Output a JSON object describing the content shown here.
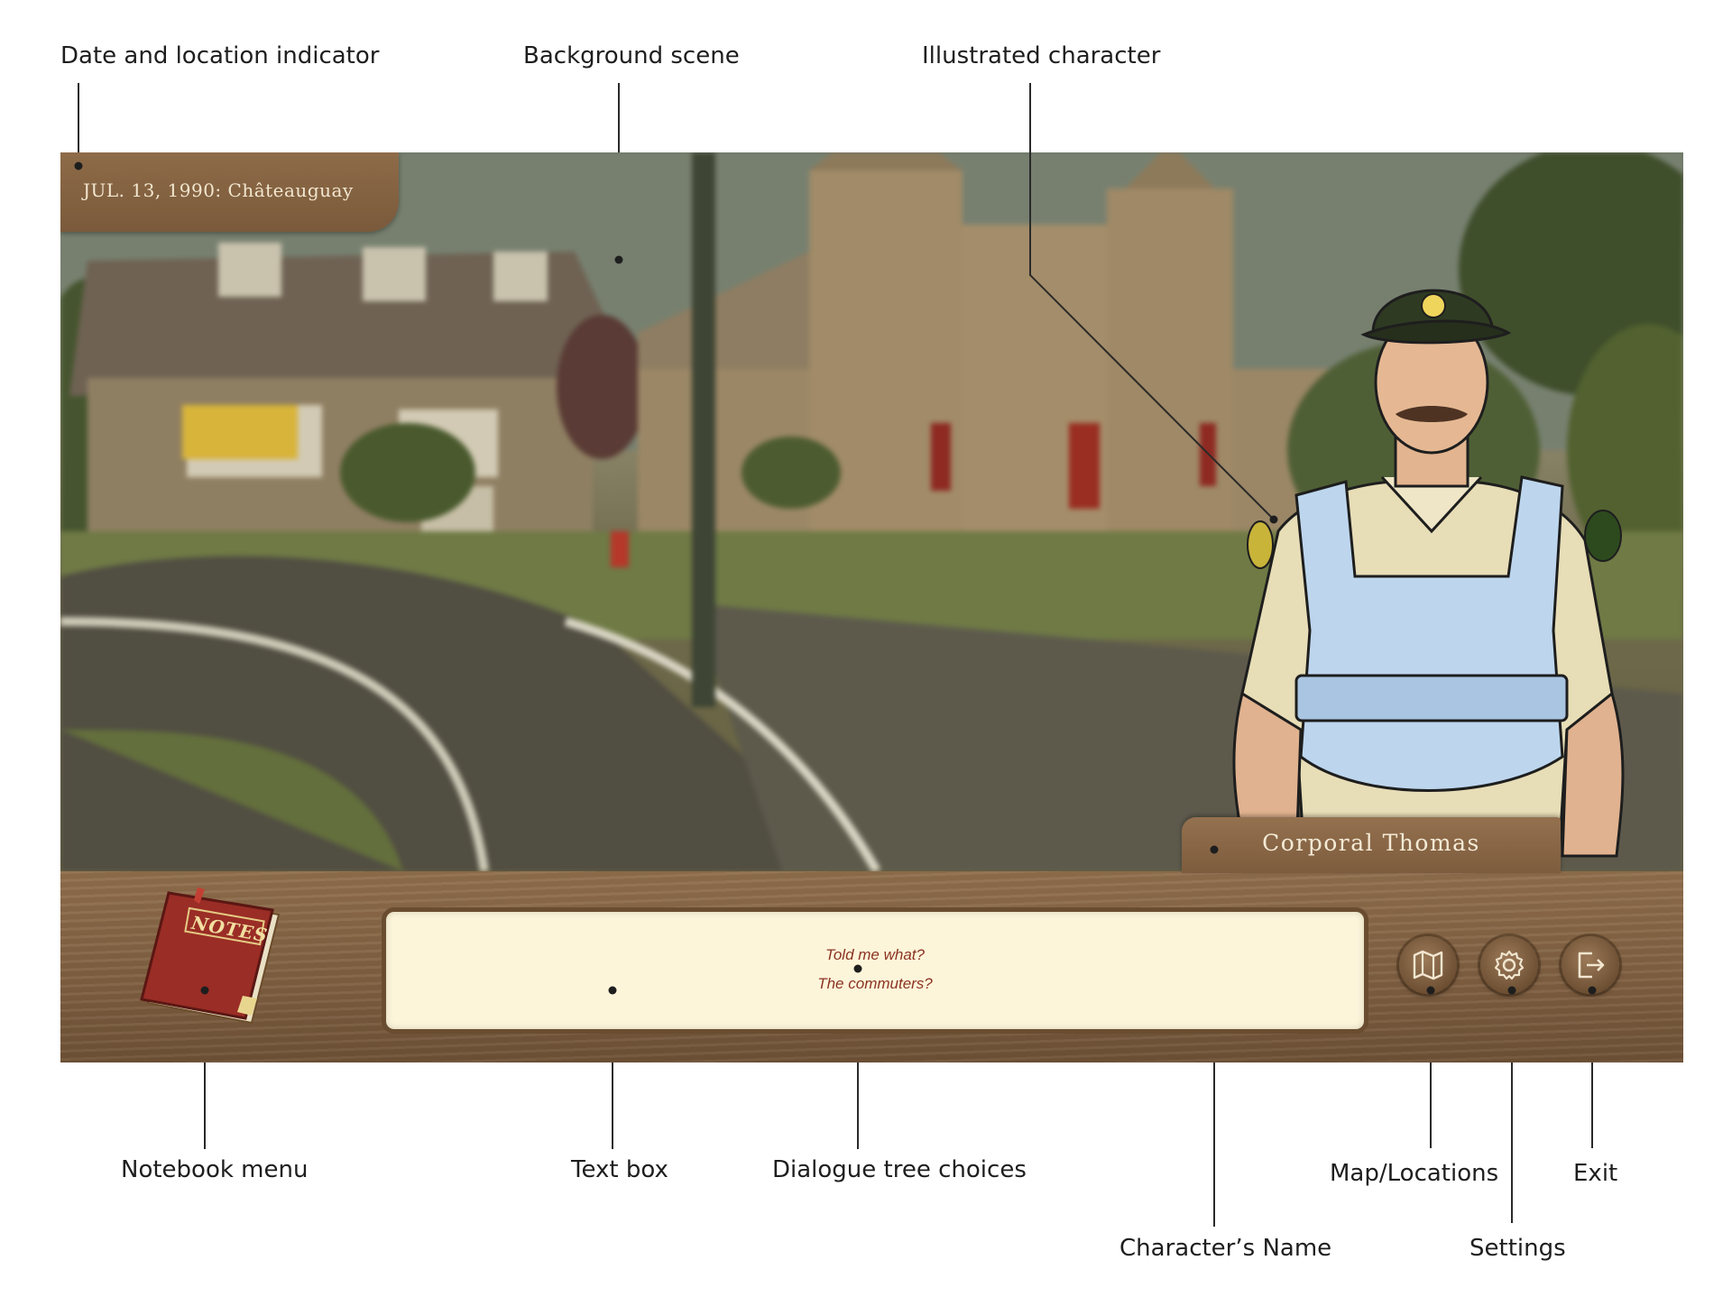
{
  "annotations": {
    "date_location": "Date and location indicator",
    "background_scene": "Background scene",
    "illustrated_character": "Illustrated character",
    "notebook_menu": "Notebook menu",
    "text_box": "Text box",
    "dialogue_choices": "Dialogue tree choices",
    "character_name": "Character’s Name",
    "map_locations": "Map/Locations",
    "settings": "Settings",
    "exit": "Exit"
  },
  "game": {
    "date_location": "JUL. 13, 1990: Châteauguay",
    "character_name": "Corporal Thomas",
    "notebook_label": "NOTES",
    "dialogue_choices": [
      "Told me what?",
      "The commuters?"
    ],
    "buttons": [
      {
        "name": "map",
        "icon": "map-icon"
      },
      {
        "name": "settings",
        "icon": "gear-icon"
      },
      {
        "name": "exit",
        "icon": "exit-icon"
      }
    ]
  },
  "colors": {
    "wood": "#7e5e40",
    "textbox_bg": "#fdf5da",
    "choice_text": "#8c3322",
    "name_text": "#f4ead6"
  }
}
